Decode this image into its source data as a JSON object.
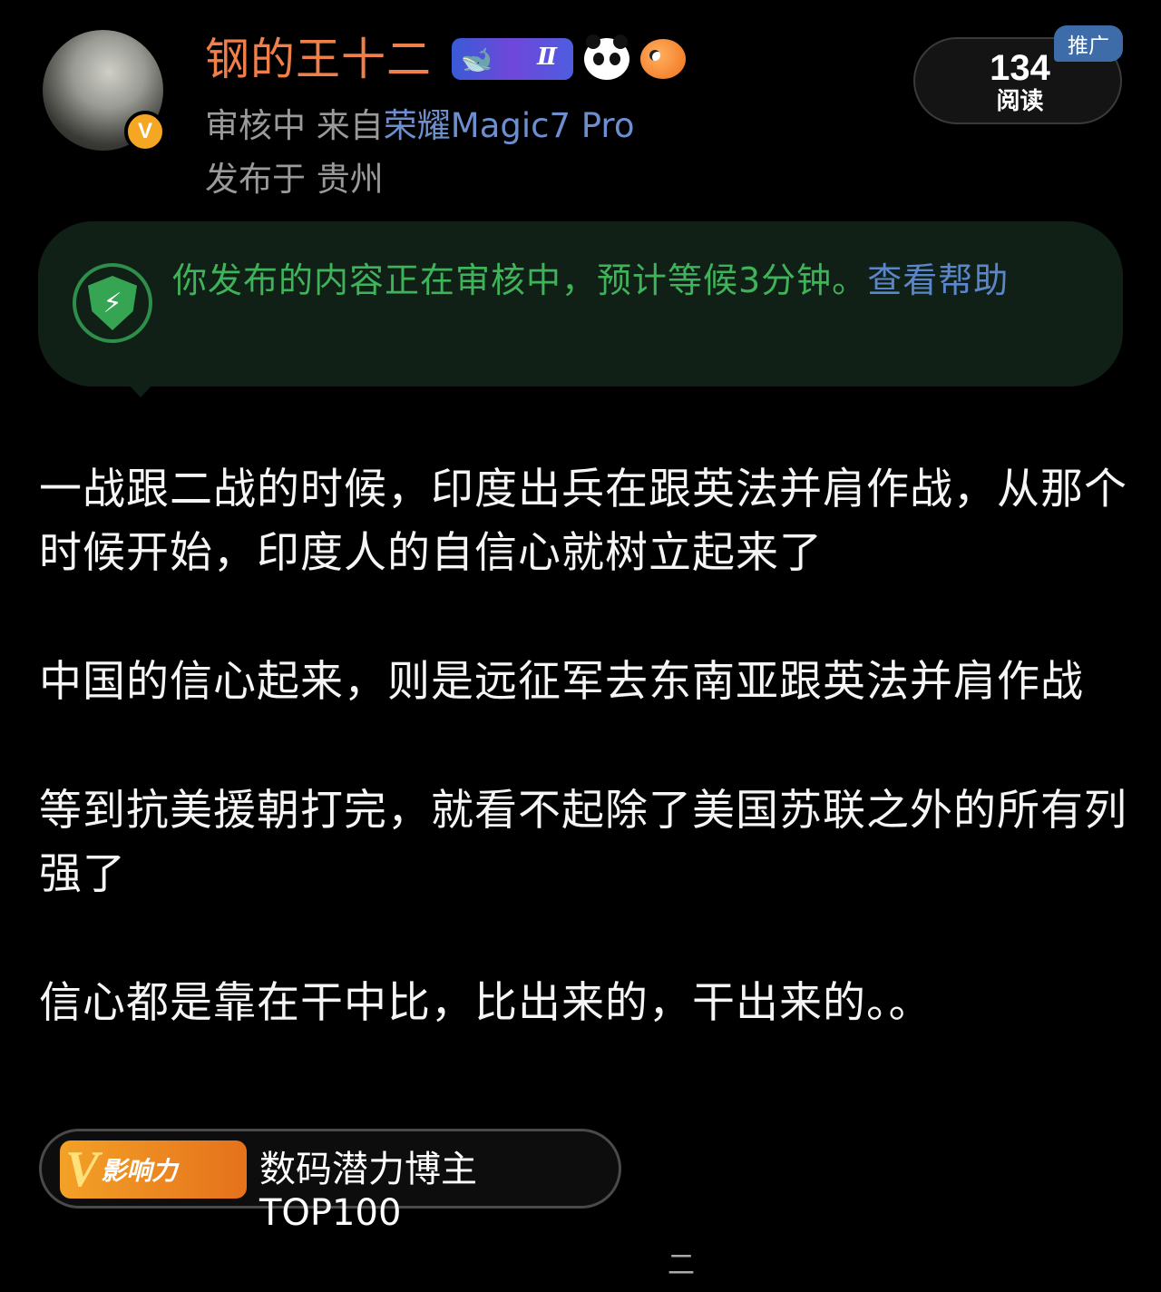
{
  "author": {
    "name": "钢的王十二",
    "verified_badge": "V",
    "level_badge": "Ⅱ",
    "status": "审核中",
    "source_prefix": "来自",
    "device": "荣耀Magic7 Pro",
    "location_line": "发布于 贵州"
  },
  "stats": {
    "reads": "134",
    "reads_label": "阅读",
    "promo_label": "推广"
  },
  "notice": {
    "message": "你发布的内容正在审核中，预计等候3分钟。",
    "help_link": "查看帮助",
    "icon": "shield-lightning-icon"
  },
  "post": {
    "paragraphs": [
      "一战跟二战的时候，印度出兵在跟英法并肩作战，从那个时候开始，印度人的自信心就树立起来了",
      "中国的信心起来，则是远征军去东南亚跟英法并肩作战",
      "等到抗美援朝打完，就看不起除了美国苏联之外的所有列强了",
      "信心都是靠在干中比，比出来的，干出来的。。"
    ]
  },
  "influence": {
    "badge_letter": "V",
    "badge_text": "影响力",
    "label": "数码潜力博主TOP100"
  },
  "footer": {
    "partial_text": "二"
  },
  "colors": {
    "username": "#f07f4a",
    "device_link": "#6d8fd0",
    "notice_text": "#3fb35a",
    "help_link": "#5b86c9",
    "badge_orange": "#f5a623"
  }
}
